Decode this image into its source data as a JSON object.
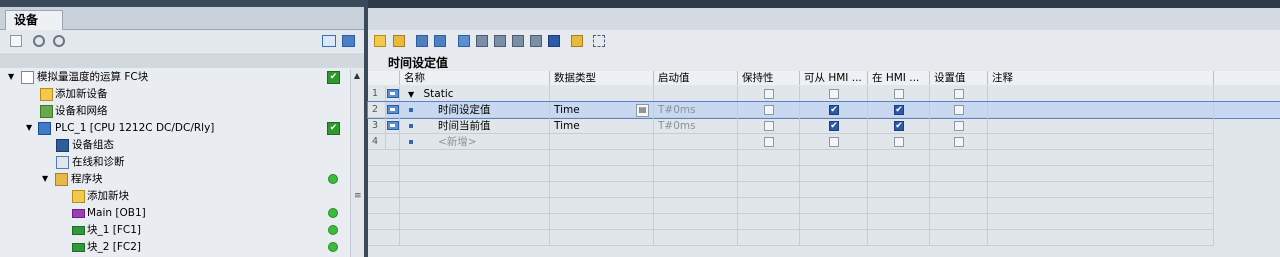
{
  "left_panel": {
    "tab_label": "设备",
    "tree": [
      {
        "label": "模拟量温度的运算  FC块",
        "status": "check",
        "expand": "▼"
      },
      {
        "label": "添加新设备",
        "status": "",
        "expand": ""
      },
      {
        "label": "设备和网络",
        "status": "",
        "expand": ""
      },
      {
        "label": "PLC_1 [CPU 1212C DC/DC/Rly]",
        "status": "check",
        "expand": "▼"
      },
      {
        "label": "设备组态",
        "status": "",
        "expand": ""
      },
      {
        "label": "在线和诊断",
        "status": "",
        "expand": ""
      },
      {
        "label": "程序块",
        "status": "dot",
        "expand": "▼"
      },
      {
        "label": "添加新块",
        "status": "",
        "expand": ""
      },
      {
        "label": "Main [OB1]",
        "status": "dot",
        "expand": ""
      },
      {
        "label": "块_1 [FC1]",
        "status": "dot",
        "expand": ""
      },
      {
        "label": "块_2 [FC2]",
        "status": "dot",
        "expand": ""
      }
    ],
    "scroll_up": "▲",
    "scroll_grip": "≡"
  },
  "editor": {
    "table_title": "时间设定值",
    "columns": [
      "",
      "名称",
      "数据类型",
      "启动值",
      "保持性",
      "可从 HMI ...",
      "在 HMI ...",
      "设置值",
      "注释"
    ],
    "rows": [
      {
        "num": "1",
        "expand": "▼",
        "name": "Static",
        "type": "",
        "start": "",
        "retain": false,
        "hmi_access": false,
        "hmi_visible": false,
        "setpoint": false
      },
      {
        "num": "2",
        "expand": "",
        "name": "时间设定值",
        "type": "Time",
        "start": "T#0ms",
        "retain": false,
        "hmi_access": true,
        "hmi_visible": true,
        "setpoint": false
      },
      {
        "num": "3",
        "expand": "",
        "name": "时间当前值",
        "type": "Time",
        "start": "T#0ms",
        "retain": false,
        "hmi_access": true,
        "hmi_visible": true,
        "setpoint": false
      },
      {
        "num": "4",
        "expand": "",
        "name": "<新增>",
        "type": "",
        "start": "",
        "retain": false,
        "hmi_access": false,
        "hmi_visible": false,
        "setpoint": false
      }
    ],
    "check_glyph": "✔",
    "dropdown_glyph": "▤"
  },
  "colors": {
    "selected_row": "#c7d8f0",
    "selected_border": "#5a82c4",
    "accent_blue": "#2d5aa7",
    "status_green": "#3dbb3d"
  }
}
